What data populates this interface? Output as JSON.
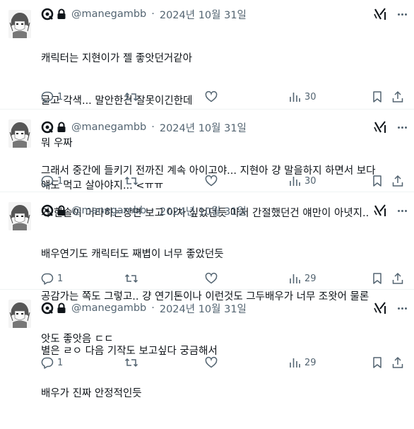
{
  "colors": {
    "text": "#0f1419",
    "secondary": "#536471",
    "divider": "#eff3f4"
  },
  "tweets": [
    {
      "handle": "@manegambb",
      "sep": "·",
      "date": "2024년 10월 31일",
      "lines": [
        "캐릭터는 지현이가 젤 좋앗던거같아",
        "글고 각색... 말안한건 잘못이긴한데",
        "뭐 우짜",
        "얘도 먹고 살아야지... <ㅠㅠ"
      ],
      "replies": "1",
      "views": "30"
    },
    {
      "handle": "@manegambb",
      "sep": "·",
      "date": "2024년 10월 31일",
      "lines": [
        "그래서 중간에 들키기 전까진 계속 아이고야... 지현아 걍 말을하지 하면서 보다",
        "가 한솔이 머라하는장면 보고 아차 싶었던듯 마저 간절했던건 얘만이 아녓지.."
      ],
      "replies": "1",
      "views": "30"
    },
    {
      "handle": "@manegambb",
      "sep": "·",
      "date": "2024년 10월 31일",
      "lines": [
        "배우연기도 캐릭터도 째볍이 너무 좋았던듯",
        "공감가는 쪽도 그렇고.. 걍 연기톤이나 이런것도 그두배우가 너무 조왓어 물론",
        "앗도 좋앗음 ㄷㄷ"
      ],
      "replies": "1",
      "views": "29"
    },
    {
      "handle": "@manegambb",
      "sep": "·",
      "date": "2024년 10월 31일",
      "lines": [
        "별은 ㄹㅇ 다음 기작도 보고싶다 궁금해서",
        "배우가 진짜 안정적인듯"
      ],
      "replies": "1",
      "views": "29"
    }
  ]
}
